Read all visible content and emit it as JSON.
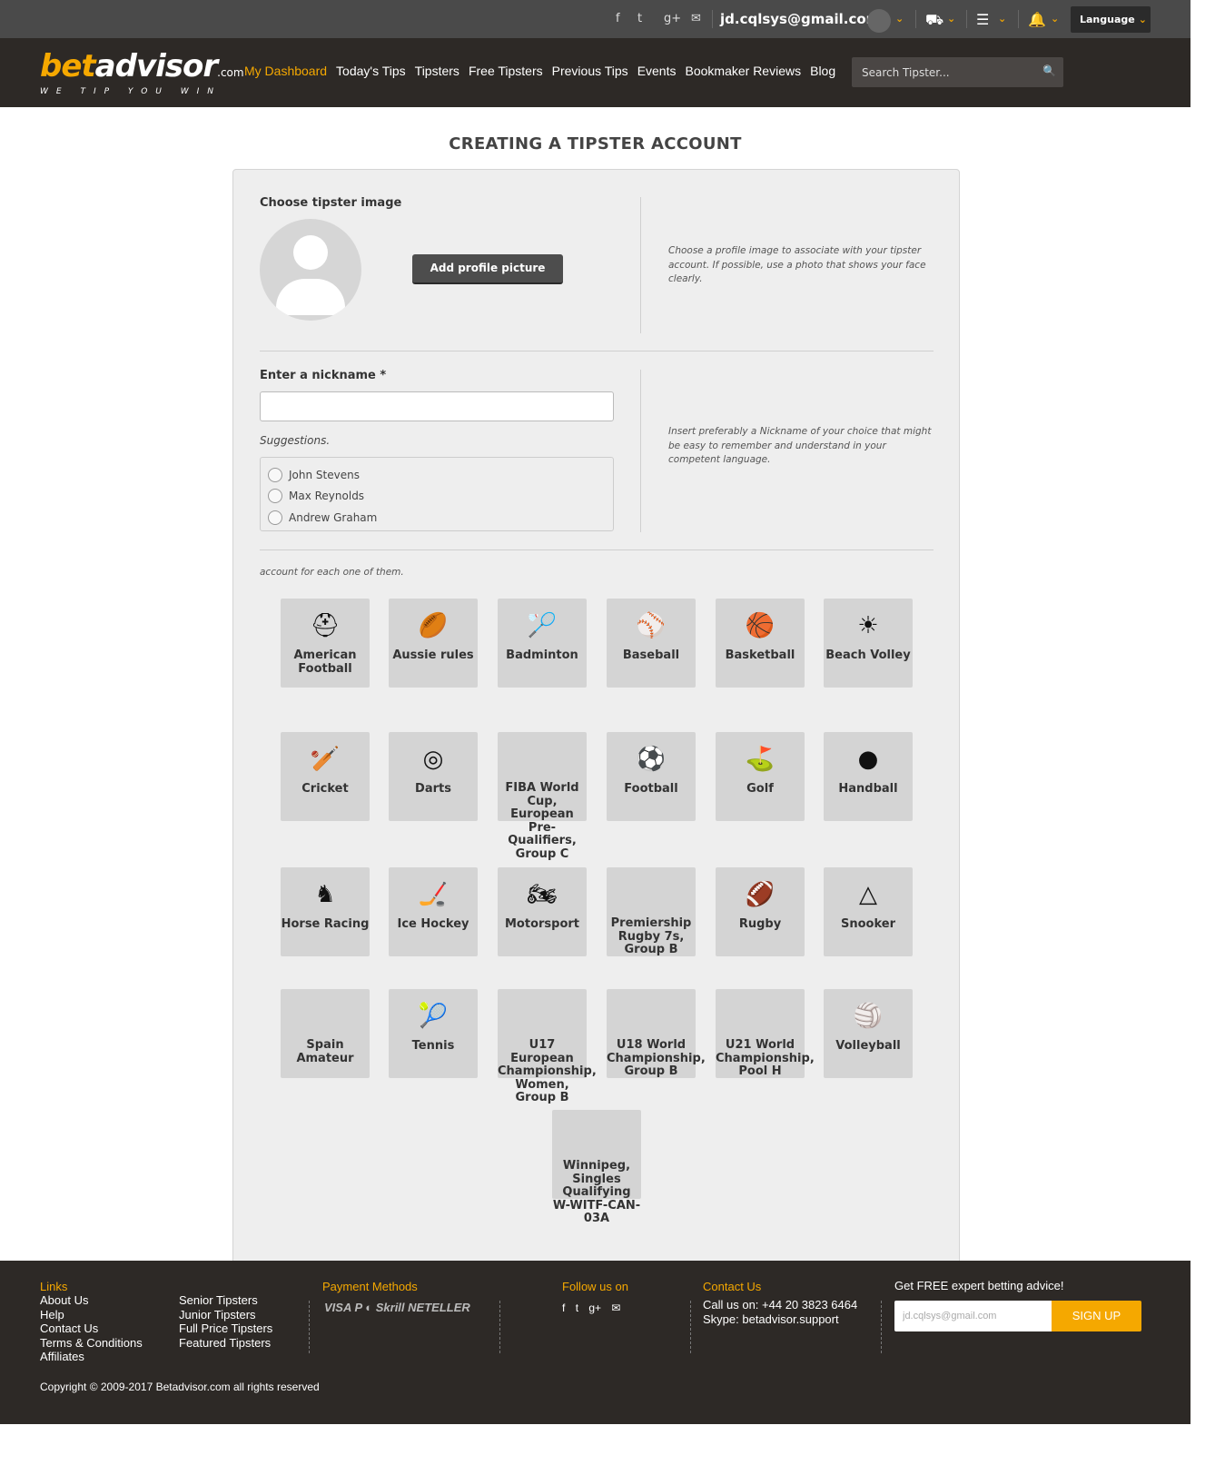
{
  "topbar": {
    "social": [
      "f",
      "t",
      "g+",
      "✉"
    ],
    "email": "jd.cqlsys@gmail.com",
    "language_label": "Language"
  },
  "header": {
    "logo_main_1": "bet",
    "logo_main_2": "advisor",
    "logo_suffix": ".com",
    "logo_tagline": "WE TIP YOU WIN",
    "nav": [
      "My Dashboard",
      "Today's Tips",
      "Tipsters",
      "Free Tipsters",
      "Previous Tips",
      "Events",
      "Bookmaker Reviews",
      "Blog"
    ],
    "search_placeholder": "Search Tipster..."
  },
  "page": {
    "title": "CREATING A TIPSTER ACCOUNT",
    "image_section": {
      "label": "Choose tipster image",
      "button": "Add profile picture",
      "help": "Choose a profile image to associate with your tipster account. If possible, use a photo that shows your face clearly."
    },
    "nickname_section": {
      "label": "Enter a nickname *",
      "value": "",
      "suggestions_label": "Suggestions.",
      "suggestions": [
        "John Stevens",
        "Max Reynolds",
        "Andrew Graham"
      ],
      "help": "Insert preferably a Nickname of your choice that might be easy to remember and understand in your competent language."
    },
    "sports_intro": "account for each one of them.",
    "sports": [
      {
        "name": "American Football",
        "icon": "helmet-icon",
        "glyph": "⛑"
      },
      {
        "name": "Aussie rules",
        "icon": "aussie-ball-icon",
        "glyph": "🏉"
      },
      {
        "name": "Badminton",
        "icon": "shuttlecock-icon",
        "glyph": "🏸"
      },
      {
        "name": "Baseball",
        "icon": "baseball-icon",
        "glyph": "⚾"
      },
      {
        "name": "Basketball",
        "icon": "basketball-icon",
        "glyph": "🏀"
      },
      {
        "name": "Beach Volley",
        "icon": "beach-volley-icon",
        "glyph": "☀"
      },
      {
        "name": "Cricket",
        "icon": "cricket-bat-icon",
        "glyph": "🏏"
      },
      {
        "name": "Darts",
        "icon": "target-icon",
        "glyph": "◎"
      },
      {
        "name": "FIBA World Cup, European Pre-Qualifiers, Group C",
        "icon": "",
        "glyph": ""
      },
      {
        "name": "Football",
        "icon": "football-icon",
        "glyph": "⚽"
      },
      {
        "name": "Golf",
        "icon": "golf-ball-icon",
        "glyph": "⛳"
      },
      {
        "name": "Handball",
        "icon": "handball-icon",
        "glyph": "●"
      },
      {
        "name": "Horse Racing",
        "icon": "horse-head-icon",
        "glyph": "♞"
      },
      {
        "name": "Ice Hockey",
        "icon": "hockey-stick-icon",
        "glyph": "🏒"
      },
      {
        "name": "Motorsport",
        "icon": "motorbike-icon",
        "glyph": "🏍"
      },
      {
        "name": "Premiership Rugby 7s, Group B",
        "icon": "",
        "glyph": ""
      },
      {
        "name": "Rugby",
        "icon": "rugby-ball-icon",
        "glyph": "🏈"
      },
      {
        "name": "Snooker",
        "icon": "snooker-balls-icon",
        "glyph": "△"
      },
      {
        "name": "Spain Amateur",
        "icon": "",
        "glyph": ""
      },
      {
        "name": "Tennis",
        "icon": "tennis-racket-icon",
        "glyph": "🎾"
      },
      {
        "name": "U17 European Championship, Women, Group B",
        "icon": "",
        "glyph": ""
      },
      {
        "name": "U18 World Championship, Group B",
        "icon": "",
        "glyph": ""
      },
      {
        "name": "U21 World Championship, Pool H",
        "icon": "",
        "glyph": ""
      },
      {
        "name": "Volleyball",
        "icon": "volleyball-net-icon",
        "glyph": "🏐"
      },
      {
        "name": "Winnipeg, Singles Qualifying W-WITF-CAN-03A",
        "icon": "",
        "glyph": ""
      }
    ]
  },
  "footer": {
    "links_heading": "Links",
    "links_col1": [
      "About Us",
      "Help",
      "Contact Us",
      "Terms & Conditions",
      "Affiliates"
    ],
    "links_col2": [
      "Senior Tipsters",
      "Junior Tipsters",
      "Full Price Tipsters",
      "Featured Tipsters"
    ],
    "payment_heading": "Payment Methods",
    "payment_methods": "VISA  P  ◐  Skrill  NETELLER",
    "follow_heading": "Follow us on",
    "follow_icons": [
      "f",
      "t",
      "g+",
      "✉"
    ],
    "contact_heading": "Contact Us",
    "contact_phone": "Call us on: +44 20 3823 6464",
    "contact_skype": "Skype: betadvisor.support",
    "newsletter_heading": "Get FREE expert betting advice!",
    "newsletter_placeholder": "jd.cqlsys@gmail.com",
    "newsletter_button": "SIGN UP",
    "copyright": "Copyright © 2009-2017 Betadvisor.com all rights reserved"
  },
  "colors": {
    "accent": "#f5a800",
    "topbar": "#4a4a4a",
    "header": "#2d2926",
    "tile": "#d4d4d4"
  }
}
